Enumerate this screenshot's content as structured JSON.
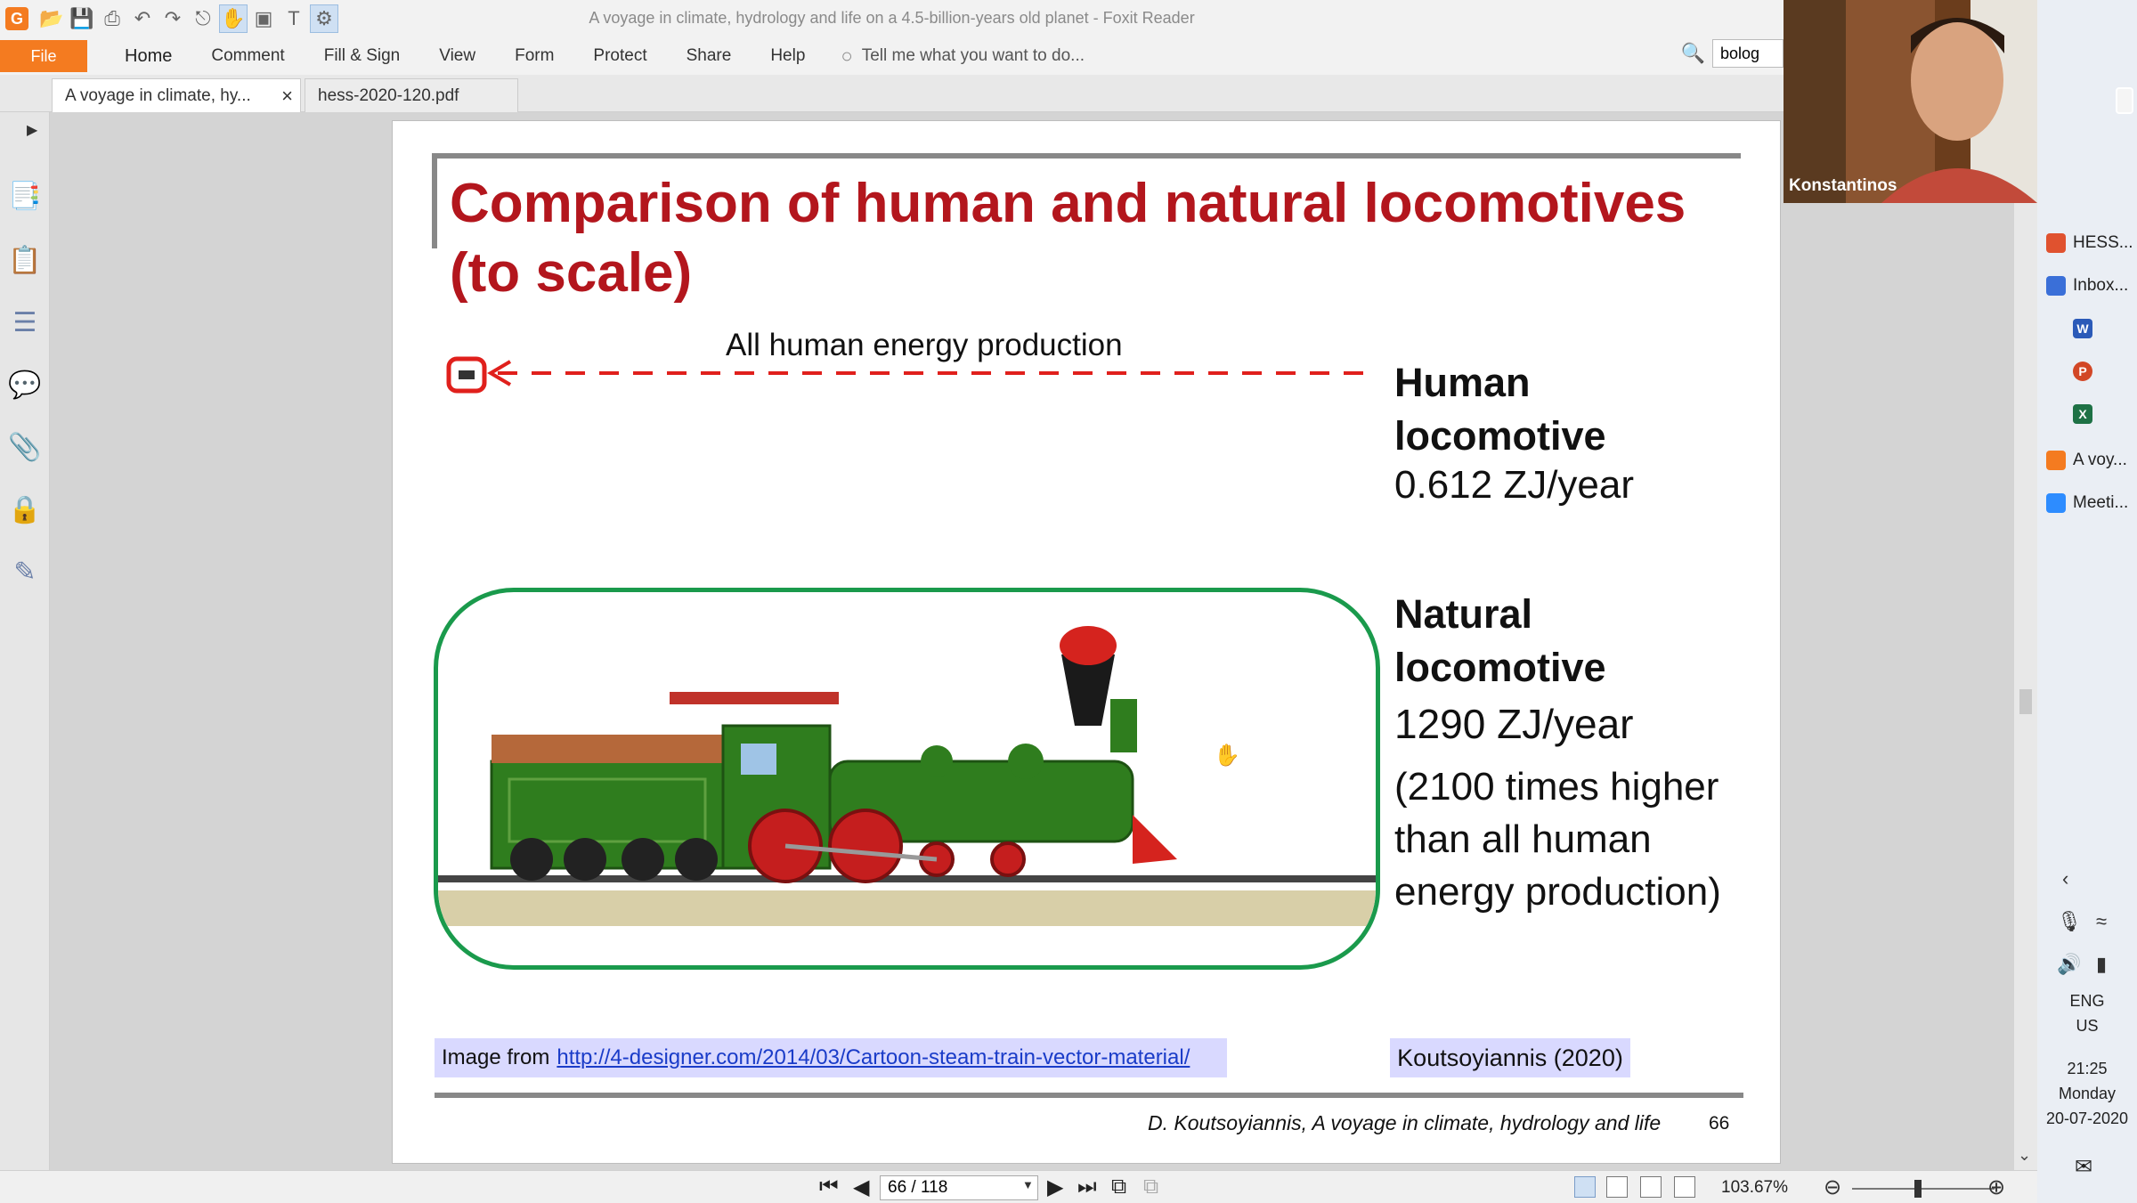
{
  "window": {
    "title": "A voyage in climate, hydrology and life on a 4.5-billion-years old planet - Foxit Reader"
  },
  "ribbon": {
    "file": "File",
    "tabs": [
      "Home",
      "Comment",
      "Fill & Sign",
      "View",
      "Form",
      "Protect",
      "Share",
      "Help"
    ],
    "tell_me": "Tell me what you want to do...",
    "find_value": "bolog"
  },
  "doc_tabs": [
    "A voyage in climate, hy...",
    "hess-2020-120.pdf"
  ],
  "slide": {
    "title": "Comparison of human and natural locomotives (to scale)",
    "human_energy_label": "All human energy production",
    "human_locomotive": "Human locomotive",
    "human_value": "0.612 ZJ/year",
    "natural_locomotive": "Natural locomotive",
    "natural_value": "1290 ZJ/year",
    "times_text": "(2100 times higher than all human energy production)",
    "credit_prefix": "Image from",
    "credit_link": "http://4-designer.com/2014/03/Cartoon-steam-train-vector-material/",
    "citation": "Koutsoyiannis (2020)",
    "footer_author": "D. Koutsoyiannis, A voyage in climate, hydrology and life",
    "page_number": "66"
  },
  "status": {
    "page_indicator": "66 / 118",
    "zoom": "103.67%"
  },
  "video": {
    "participant": "Konstantinos"
  },
  "taskbar": {
    "items": [
      "HESS...",
      "Inbox...",
      "W",
      "P",
      "X",
      "A voy...",
      "Meeti..."
    ],
    "language": "ENG\nUS",
    "lang_line1": "ENG",
    "lang_line2": "US",
    "time": "21:25",
    "day": "Monday",
    "date": "20-07-2020"
  },
  "colors": {
    "accent_orange": "#f47b20",
    "title_red": "#b3161d",
    "frame_green": "#1a9a4c",
    "highlight": "#d9d9ff"
  }
}
